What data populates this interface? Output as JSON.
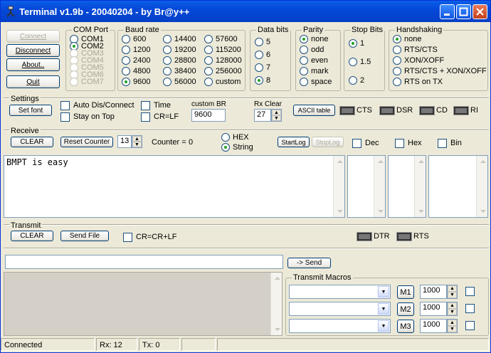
{
  "window": {
    "title": "Terminal v1.9b - 20040204 - by Br@y++"
  },
  "buttons": {
    "connect": "Connect",
    "disconnect": "Disconnect",
    "about": "About..",
    "quit": "Quit",
    "set_font": "Set font",
    "ascii_table": "ASCII table",
    "rx_clear": "CLEAR",
    "reset_counter": "Reset Counter",
    "start_log": "StartLog",
    "stop_log": "StopLog",
    "tx_clear": "CLEAR",
    "send_file": "Send File",
    "send": "-> Send",
    "m1": "M1",
    "m2": "M2",
    "m3": "M3"
  },
  "com_port": {
    "label": "COM Port",
    "options": [
      "COM1",
      "COM2",
      "COM3",
      "COM4",
      "COM5",
      "COM6",
      "COM7"
    ],
    "selected": "COM2"
  },
  "baud_rate": {
    "label": "Baud rate",
    "col1": [
      "600",
      "1200",
      "2400",
      "4800",
      "9600"
    ],
    "col2": [
      "14400",
      "19200",
      "28800",
      "38400",
      "56000"
    ],
    "col3": [
      "57600",
      "115200",
      "128000",
      "256000",
      "custom"
    ],
    "selected": "9600"
  },
  "data_bits": {
    "label": "Data bits",
    "options": [
      "5",
      "6",
      "7",
      "8"
    ],
    "selected": "8"
  },
  "parity": {
    "label": "Parity",
    "options": [
      "none",
      "odd",
      "even",
      "mark",
      "space"
    ],
    "selected": "none"
  },
  "stop_bits": {
    "label": "Stop Bits",
    "options": [
      "1",
      "1.5",
      "2"
    ],
    "selected": "1"
  },
  "handshaking": {
    "label": "Handshaking",
    "options": [
      "none",
      "RTS/CTS",
      "XON/XOFF",
      "RTS/CTS + XON/XOFF",
      "RTS on TX"
    ],
    "selected": "none"
  },
  "settings": {
    "label": "Settings",
    "auto_dis": "Auto Dis/Connect",
    "stay_on_top": "Stay on Top",
    "time": "Time",
    "crlf": "CR=LF",
    "custom_br_label": "custom BR",
    "custom_br_value": "9600",
    "rx_clear_label": "Rx Clear",
    "rx_clear_value": "27",
    "leds": [
      "CTS",
      "DSR",
      "CD",
      "RI"
    ]
  },
  "receive": {
    "label": "Receive",
    "counter_value": "13",
    "counter_label": "Counter =",
    "counter_count": "0",
    "hex": "HEX",
    "string": "String",
    "dec": "Dec",
    "hexchk": "Hex",
    "bin": "Bin",
    "text": "BMPT is easy"
  },
  "transmit": {
    "label": "Transmit",
    "crcrlf": "CR=CR+LF",
    "dtr": "DTR",
    "rts": "RTS",
    "input_value": ""
  },
  "macros": {
    "label": "Transmit Macros",
    "intervals": [
      "1000",
      "1000",
      "1000"
    ]
  },
  "status": {
    "state": "Connected",
    "rx": "Rx: 12",
    "tx": "Tx: 0"
  },
  "colors": {
    "titlebar": "#0548d8",
    "face": "#ece9d8"
  }
}
